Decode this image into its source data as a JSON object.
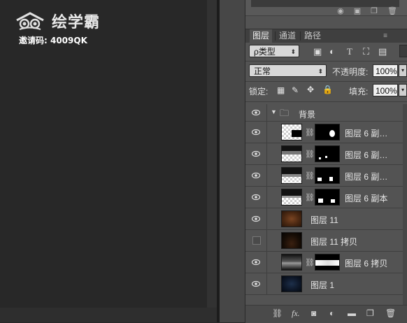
{
  "logo": {
    "text": "绘学霸",
    "icon": "cloud-swirl-logo-icon"
  },
  "invite": {
    "text": "邀请码: 4009QK"
  },
  "panel_tabs": [
    {
      "label": "图层",
      "active": true
    },
    {
      "label": "通道",
      "active": false
    },
    {
      "label": "路径",
      "active": false
    }
  ],
  "filter": {
    "kind_label": "ρ类型",
    "icons": [
      "image-filter-icon",
      "adjustment-filter-icon",
      "type-filter-icon",
      "shape-filter-icon",
      "smart-object-filter-icon"
    ],
    "type_glyph": "T"
  },
  "blend": {
    "mode": "正常",
    "opacity_label": "不透明度:",
    "opacity_value": "100%"
  },
  "lock": {
    "label": "锁定:",
    "fill_label": "填充:",
    "fill_value": "100%"
  },
  "layers": [
    {
      "name": "背景",
      "type": "group",
      "visible": true
    },
    {
      "name": "图层 6 副…",
      "visible": true,
      "has_mask": true
    },
    {
      "name": "图层 6 副…",
      "visible": true,
      "has_mask": true
    },
    {
      "name": "图层 6 副…",
      "visible": true,
      "has_mask": true
    },
    {
      "name": "图层 6 副本",
      "visible": true,
      "has_mask": true
    },
    {
      "name": "图层 11",
      "visible": true,
      "has_mask": false
    },
    {
      "name": "图层 11 拷贝",
      "visible": false,
      "has_mask": false
    },
    {
      "name": "图层 6 拷贝",
      "visible": true,
      "has_mask": true
    },
    {
      "name": "图层 1",
      "visible": true,
      "has_mask": false
    }
  ],
  "bottom_bar": {
    "icons": [
      "link-layers-icon",
      "fx-icon",
      "add-mask-icon",
      "adjustment-layer-icon",
      "new-group-icon",
      "new-layer-icon",
      "trash-icon"
    ],
    "fx_label": "fx."
  },
  "colors": {
    "panel": "#535353",
    "canvas": "#282828",
    "tab_bar": "#3f3f3f"
  }
}
